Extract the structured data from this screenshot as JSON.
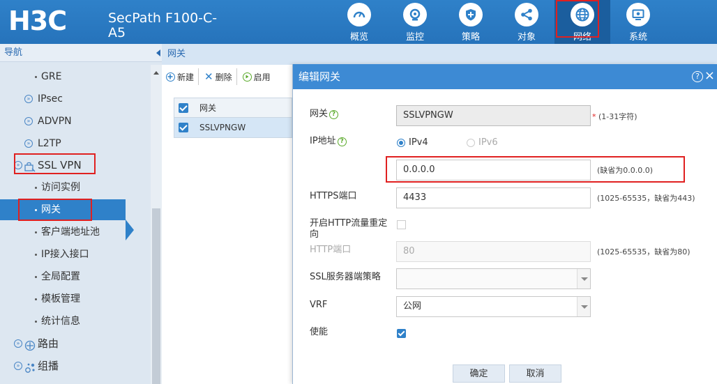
{
  "header": {
    "logo": "H3C",
    "product": "SecPath F100-C-A5",
    "nav": [
      {
        "label": "概览",
        "icon": "gauge-icon"
      },
      {
        "label": "监控",
        "icon": "monitor-icon"
      },
      {
        "label": "策略",
        "icon": "shield-icon"
      },
      {
        "label": "对象",
        "icon": "share-icon"
      },
      {
        "label": "网络",
        "icon": "globe-icon",
        "active": true
      },
      {
        "label": "系统",
        "icon": "settings-screen-icon"
      }
    ]
  },
  "sidebar": {
    "title": "导航",
    "items": [
      {
        "label": "GRE"
      },
      {
        "label": "IPsec"
      },
      {
        "label": "ADVPN"
      },
      {
        "label": "L2TP"
      },
      {
        "label": "SSL VPN"
      },
      {
        "label": "访问实例"
      },
      {
        "label": "网关"
      },
      {
        "label": "客户端地址池"
      },
      {
        "label": "IP接入接口"
      },
      {
        "label": "全局配置"
      },
      {
        "label": "模板管理"
      },
      {
        "label": "统计信息"
      },
      {
        "label": "路由"
      },
      {
        "label": "组播"
      }
    ]
  },
  "main": {
    "breadcrumb": "网关",
    "toolbar": {
      "new_label": "新建",
      "delete_label": "删除",
      "enable_label": "启用"
    },
    "table": {
      "header": "网关",
      "rows": [
        "SSLVPNGW"
      ]
    }
  },
  "dialog": {
    "title": "编辑网关",
    "help_symbol": "?",
    "close_symbol": "×",
    "gateway": {
      "label": "网关",
      "value": "SSLVPNGW",
      "required_mark": "*",
      "hint": "(1-31字符)"
    },
    "ip": {
      "label": "IP地址",
      "ipv4_label": "IPv4",
      "ipv6_label": "IPv6",
      "value": "0.0.0.0",
      "hint": "(缺省为0.0.0.0)"
    },
    "https_port": {
      "label": "HTTPS端口",
      "value": "4433",
      "hint": "(1025-65535，缺省为443)"
    },
    "http_redirect": {
      "label": "开启HTTP流量重定向"
    },
    "http_port": {
      "label": "HTTP端口",
      "placeholder": "80",
      "hint": "(1025-65535，缺省为80)"
    },
    "ssl_policy": {
      "label": "SSL服务器端策略",
      "value": ""
    },
    "vrf": {
      "label": "VRF",
      "value": "公网"
    },
    "enable": {
      "label": "使能",
      "checked": true
    },
    "ok_label": "确定",
    "cancel_label": "取消"
  }
}
